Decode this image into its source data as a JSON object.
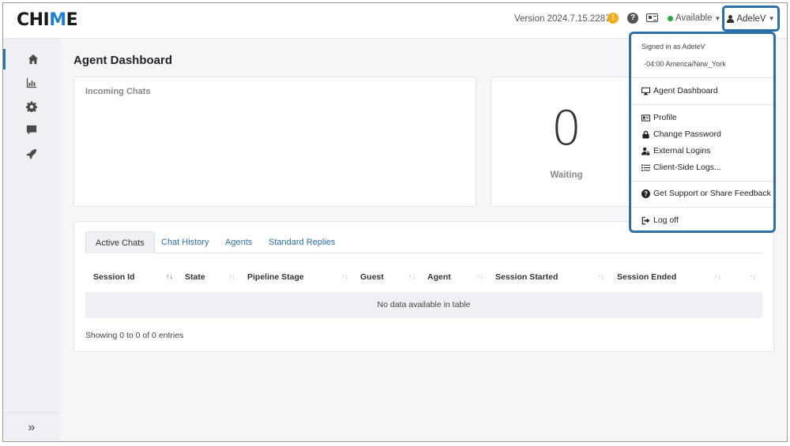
{
  "header": {
    "logo_pre": "CHI",
    "logo_accent": "M",
    "logo_post": "E",
    "version": "Version 2024.7.15.2287",
    "warning_glyph": "!",
    "help_glyph": "?",
    "status_label": "Available",
    "user_label": "AdeleV"
  },
  "sidebar": {
    "items": [
      {
        "icon": "home-icon"
      },
      {
        "icon": "bar-chart-icon"
      },
      {
        "icon": "gear-icon"
      },
      {
        "icon": "chat-icon"
      },
      {
        "icon": "rocket-icon"
      }
    ],
    "collapse_glyph": "»"
  },
  "main": {
    "title": "Agent Dashboard",
    "incoming_title": "Incoming Chats",
    "waiting_count": "0",
    "waiting_label": "Waiting",
    "tabs": [
      "Active Chats",
      "Chat History",
      "Agents",
      "Standard Replies"
    ],
    "columns": [
      "Session Id",
      "State",
      "Pipeline Stage",
      "Guest",
      "Agent",
      "Session Started",
      "Session Ended"
    ],
    "sort_glyph": "↑↓",
    "sort_active_glyph": "↑↓",
    "empty_text": "No data available in table",
    "showing_text": "Showing 0 to 0 of 0 entries"
  },
  "dropdown": {
    "signed_in": "Signed in as AdeleV",
    "timezone": "-04:00 America/New_York",
    "items": [
      "Agent Dashboard",
      "Profile",
      "Change Password",
      "External Logins",
      "Client-Side Logs...",
      "Get Support or Share Feedback",
      "Log off"
    ]
  },
  "colors": {
    "accent": "#2d6fa8",
    "available": "#28a745",
    "warning": "#f0ad1e"
  }
}
